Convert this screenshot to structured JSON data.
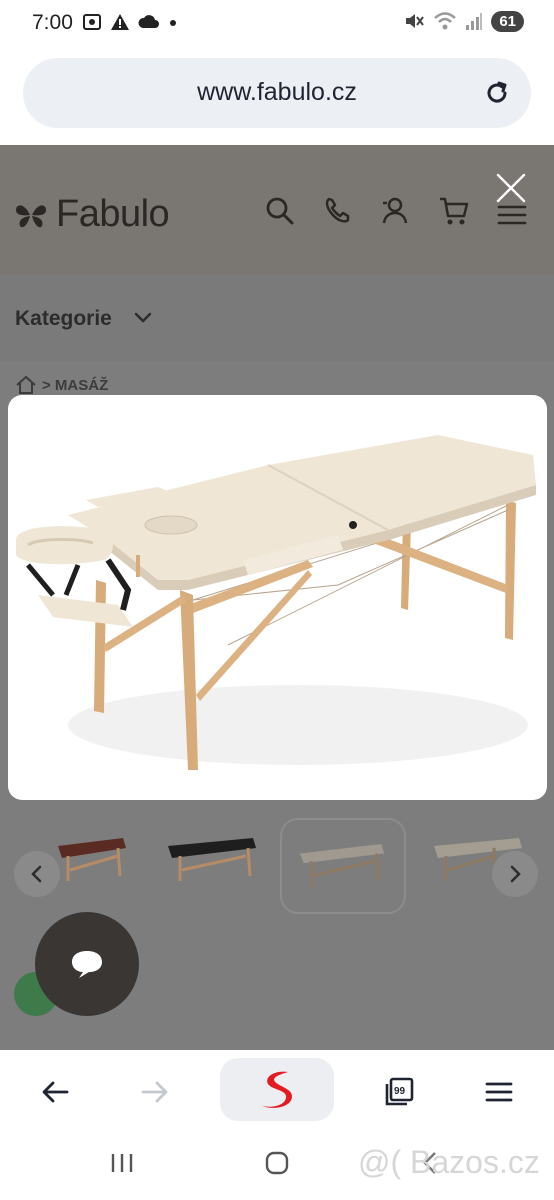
{
  "status_bar": {
    "time": "7:00",
    "battery": "61"
  },
  "browser": {
    "url": "www.fabulo.cz"
  },
  "site": {
    "logo_text": "Fabulo",
    "menu_label": "Kategorie",
    "breadcrumb": "> MASÁŽ"
  },
  "colors": {
    "accent_red": "#e31b23",
    "chat_fab": "#3a3634",
    "overlay": "#7d7d7d"
  },
  "gallery": {
    "thumbnails": [
      {
        "color": "#5a2b23"
      },
      {
        "color": "#1e1e1e"
      },
      {
        "color": "#e9e0d2"
      },
      {
        "color": "#e9e0d2"
      }
    ],
    "active_index": 2
  },
  "watermark": "@( Bazos.cz"
}
